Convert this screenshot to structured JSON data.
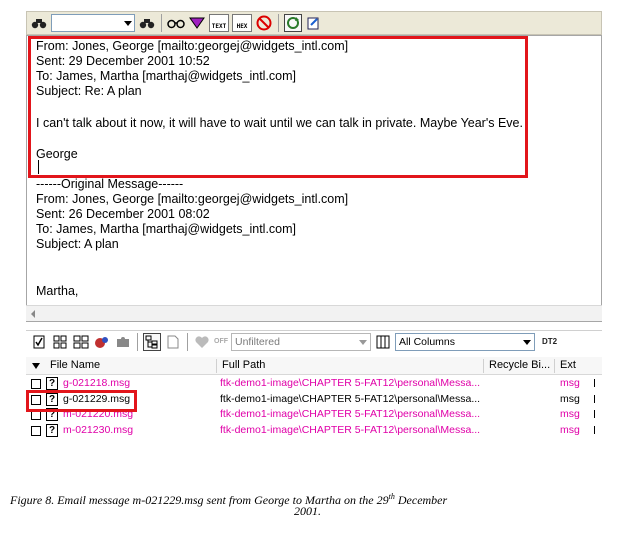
{
  "toolbar_top": {
    "icons": [
      "find-icon",
      "find-next-icon",
      "view-glasses-icon",
      "view-filter-icon",
      "text-view-icon",
      "hex-view-icon",
      "no-view-icon",
      "refresh-icon",
      "open-icon"
    ],
    "text_icon_label": "TEXT",
    "hex_icon_label": "HEX"
  },
  "email": {
    "reply": {
      "from": "From: Jones, George [mailto:georgej@widgets_intl.com]",
      "sent": "Sent: 29 December 2001 10:52",
      "to": "To: James, Martha [marthaj@widgets_intl.com]",
      "subject": "Subject: Re: A plan",
      "body": "I can't talk about it now, it will have to wait until we can talk in private. Maybe Year's Eve.",
      "signature": "George"
    },
    "original": {
      "separator": "------Original Message------",
      "from": "From: Jones, George [mailto:georgej@widgets_intl.com]",
      "sent": "Sent: 26 December 2001 08:02",
      "to": "To: James, Martha [marthaj@widgets_intl.com]",
      "subject": "Subject: A plan",
      "signature": "Martha,"
    }
  },
  "list_toolbar": {
    "off_label": "OFF",
    "filter_value": "Unfiltered",
    "columns_value": "All Columns",
    "dt_label": "DT2"
  },
  "table": {
    "columns": [
      "File Name",
      "Full Path",
      "Recycle Bi...",
      "Ext"
    ],
    "rows": [
      {
        "name": "g-021218.msg",
        "path": "ftk-demo1-image\\CHAPTER 5-FAT12\\personal\\Messa...",
        "ext": "msg",
        "deleted": true
      },
      {
        "name": "g-021229.msg",
        "path": "ftk-demo1-image\\CHAPTER 5-FAT12\\personal\\Messa...",
        "ext": "msg",
        "deleted": false
      },
      {
        "name": "m-021220.msg",
        "path": "ftk-demo1-image\\CHAPTER 5-FAT12\\personal\\Messa...",
        "ext": "msg",
        "deleted": true
      },
      {
        "name": "m-021230.msg",
        "path": "ftk-demo1-image\\CHAPTER 5-FAT12\\personal\\Messa...",
        "ext": "msg",
        "deleted": true
      }
    ]
  },
  "caption": {
    "line1_prefix": "Figure 8.     Email message m-021229.msg sent from George to Martha on the 29",
    "line1_sup": "th",
    "line1_suffix": " December",
    "line2": "2001."
  },
  "colors": {
    "highlight": "#e2151b",
    "deleted_file": "#e000a8"
  }
}
